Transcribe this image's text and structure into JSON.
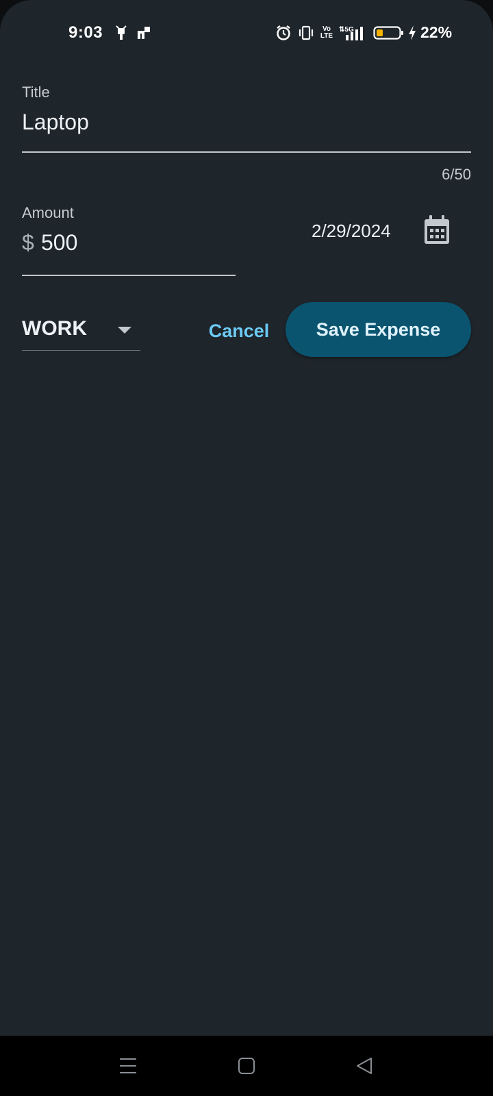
{
  "status_bar": {
    "time": "9:03",
    "battery_percent": "22%",
    "icons": [
      "notification-app-icon",
      "notification-app-icon-2",
      "alarm-icon",
      "vibrate-icon",
      "volte-icon",
      "5g-signal-icon",
      "battery-icon",
      "charging-icon"
    ]
  },
  "form": {
    "title_label": "Title",
    "title_value": "Laptop",
    "title_counter": "6/50",
    "amount_label": "Amount",
    "amount_prefix": "$",
    "amount_value": "500",
    "date": "2/29/2024",
    "category": "WORK"
  },
  "actions": {
    "cancel_label": "Cancel",
    "save_label": "Save Expense"
  },
  "nav_bar": {
    "buttons": [
      "menu-icon",
      "home-icon",
      "back-icon"
    ]
  },
  "colors": {
    "background": "#1e252b",
    "accent": "#6ccaf4",
    "primary_button": "#0b546f",
    "battery_level": "#f3b300"
  }
}
